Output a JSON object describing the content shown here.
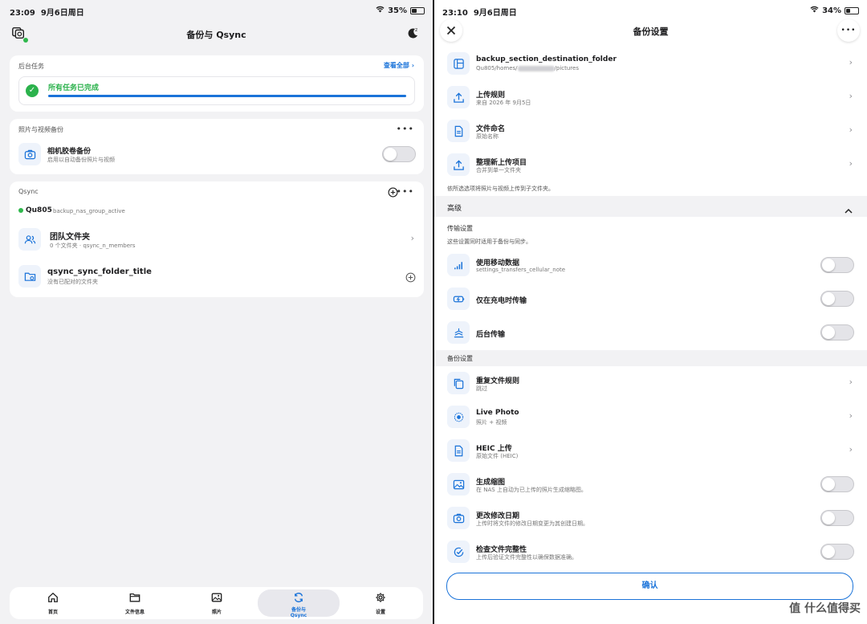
{
  "colors": {
    "accent": "#1a73d9",
    "success": "#2bb24c",
    "online": "#2fb84c"
  },
  "left": {
    "status": {
      "time": "23:09",
      "date": "9月6日周日",
      "battery": "35%",
      "battery_level": 0.35
    },
    "header": {
      "title": "备份与 Qsync"
    },
    "tasks": {
      "title": "后台任务",
      "view_all": "查看全部",
      "status": "所有任务已完成",
      "progress": 1.0
    },
    "backup": {
      "title": "照片与视频备份",
      "item_title": "相机胶卷备份",
      "item_sub": "启用以自动备份照片与视频",
      "toggle_on": false
    },
    "qsync": {
      "title": "Qsync",
      "device": "Qu805",
      "device_status": "backup_nas_group_active",
      "team_title": "团队文件夹",
      "team_sub_count": "0 个文件夹",
      "team_sub_members": "qsync_n_members",
      "sync_title": "qsync_sync_folder_title",
      "sync_sub": "没有已配对的文件夹"
    },
    "nav": [
      {
        "label": "首页",
        "icon": "home-icon"
      },
      {
        "label": "文件信息",
        "icon": "folder-icon"
      },
      {
        "label": "照片",
        "icon": "image-icon"
      },
      {
        "label": "备份与\nQsync",
        "icon": "sync-icon",
        "active": true
      },
      {
        "label": "设置",
        "icon": "gear-icon"
      }
    ]
  },
  "right": {
    "status": {
      "time": "23:10",
      "date": "9月6日周日",
      "battery": "34%",
      "battery_level": 0.34
    },
    "header": {
      "title": "备份设置"
    },
    "rows": {
      "dest_title": "backup_section_destination_folder",
      "dest_path_a": "Qu805/homes/",
      "dest_path_b": "/pictures",
      "upload_rule_title": "上传规则",
      "upload_rule_sub": "来自 2026 年 9月5日",
      "naming_title": "文件命名",
      "naming_sub": "原始名称",
      "organize_title": "整理新上传项目",
      "organize_sub": "合并到单一文件夹",
      "organize_note": "依所选选项将照片与视频上传到子文件夹。",
      "advanced": "高级",
      "transfer_header": "传输设置",
      "transfer_note": "这些设置同时适用于备份与同步。",
      "cellular_title": "使用移动数据",
      "cellular_sub": "settings_transfers_cellular_note",
      "charging_title": "仅在充电时传输",
      "background_title": "后台传输",
      "backup_header": "备份设置",
      "dup_title": "重复文件规则",
      "dup_sub": "跳过",
      "live_title": "Live Photo",
      "live_sub": "照片 + 视频",
      "heic_title": "HEIC 上传",
      "heic_sub": "原始文件 (HEIC)",
      "thumb_title": "生成缩图",
      "thumb_sub": "在 NAS 上自动为已上传的照片生成缩略图。",
      "date_title": "更改修改日期",
      "date_sub": "上传时将文件的修改日期变更为其创建日期。",
      "integrity_title": "检查文件完整性",
      "integrity_sub": "上传后验证文件完整性以确保数据准确。"
    },
    "confirm": "确认",
    "watermark": "值 什么值得买"
  }
}
